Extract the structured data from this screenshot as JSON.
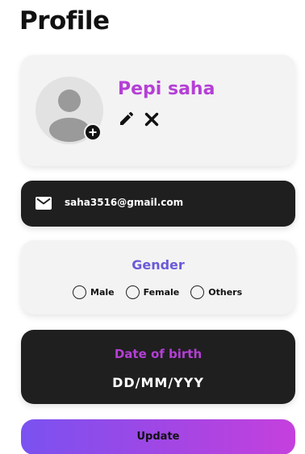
{
  "page": {
    "title": "Profile"
  },
  "profile": {
    "name": "Pepi saha",
    "avatar_icon": "default-user-avatar",
    "add_photo_icon": "plus-circle-icon",
    "edit_icon": "pencil-icon",
    "close_icon": "close-icon"
  },
  "email": {
    "icon": "mail-icon",
    "value": "saha3516@gmail.com"
  },
  "gender": {
    "title": "Gender",
    "options": [
      "Male",
      "Female",
      "Others"
    ],
    "selected": null
  },
  "dob": {
    "title": "Date of birth",
    "value": "DD/MM/YYY"
  },
  "update_button": {
    "label": "Update"
  },
  "colors": {
    "accent_purple": "#b53fd6",
    "gender_blue": "#6a5ad8",
    "card_dark": "#1f1f1f",
    "card_light": "#f3f3f3",
    "button_gradient_start": "#7a52f0",
    "button_gradient_end": "#c540dd"
  }
}
